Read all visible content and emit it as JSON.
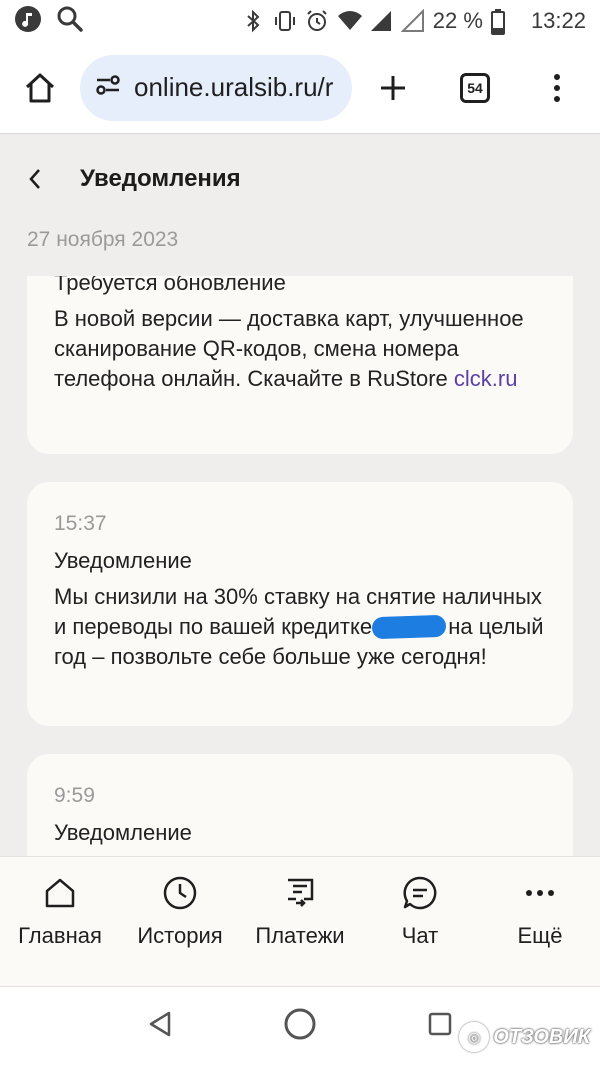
{
  "status_bar": {
    "battery": "22 %",
    "time": "13:22"
  },
  "browser": {
    "url": "online.uralsib.ru/r",
    "tabs_count": "54"
  },
  "header": {
    "title": "Уведомления"
  },
  "date_group": "27 ноября 2023",
  "notifications": [
    {
      "title": "Требуется обновление",
      "body": "В новой версии — доставка карт, улучшенное сканирование QR-кодов, смена номера телефона онлайн. Скачайте в RuStore ",
      "link": "clck.ru"
    },
    {
      "time": "15:37",
      "title": "Уведомление",
      "body_1": "Мы снизили на 30% ставку на снятие наличных и переводы по вашей кредитке ",
      "body_2": "на целый год – позвольте себе больше уже сегодня!"
    },
    {
      "time": "9:59",
      "title": "Уведомление"
    }
  ],
  "bottom_nav": [
    {
      "label": "Главная",
      "icon": "home-icon"
    },
    {
      "label": "История",
      "icon": "clock-icon"
    },
    {
      "label": "Платежи",
      "icon": "payments-icon"
    },
    {
      "label": "Чат",
      "icon": "chat-icon"
    },
    {
      "label": "Ещё",
      "icon": "more-icon"
    }
  ],
  "watermark": "ОТЗОВИК"
}
